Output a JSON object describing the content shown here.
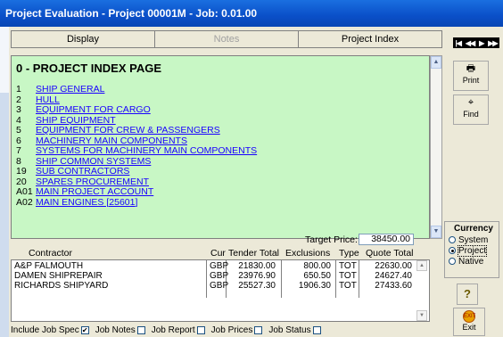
{
  "window": {
    "title": "Project Evaluation - Project 00001M - Job: 0.01.00"
  },
  "tabs": [
    {
      "label": "Display"
    },
    {
      "label": "Notes"
    },
    {
      "label": "Project Index"
    }
  ],
  "nav": {
    "icons": [
      "first-record-icon",
      "previous-record-icon",
      "next-record-icon",
      "last-record-icon"
    ]
  },
  "index": {
    "title": "0 - PROJECT INDEX PAGE",
    "items": [
      {
        "num": "1",
        "label": "SHIP GENERAL"
      },
      {
        "num": "2",
        "label": "HULL"
      },
      {
        "num": "3",
        "label": "EQUIPMENT FOR CARGO"
      },
      {
        "num": "4",
        "label": "SHIP EQUIPMENT"
      },
      {
        "num": "5",
        "label": "EQUIPMENT FOR CREW & PASSENGERS"
      },
      {
        "num": "6",
        "label": "MACHINERY MAIN COMPONENTS"
      },
      {
        "num": "7",
        "label": "SYSTEMS FOR MACHINERY MAIN COMPONENTS"
      },
      {
        "num": "8",
        "label": "SHIP COMMON SYSTEMS"
      },
      {
        "num": "19",
        "label": "SUB CONTRACTORS"
      },
      {
        "num": "20",
        "label": "SPARES PROCUREMENT"
      },
      {
        "num": "A01",
        "label": "MAIN PROJECT ACCOUNT"
      },
      {
        "num": "A02",
        "label": "MAIN ENGINES [25601]"
      }
    ]
  },
  "side": {
    "print_label": "Print",
    "find_label": "Find",
    "exit_label": "Exit",
    "exit_icon_text": "EXIT",
    "help_glyph": "?"
  },
  "target": {
    "label": "Target Price:",
    "value": "38450.00"
  },
  "table": {
    "headers": {
      "contractor": "Contractor",
      "cur": "Cur",
      "tender": "Tender Total",
      "exclusions": "Exclusions",
      "type": "Type",
      "quote": "Quote Total"
    },
    "rows": [
      {
        "contractor": "A&P FALMOUTH",
        "cur": "GBP",
        "tender": "21830.00",
        "exclusions": "800.00",
        "type": "TOT",
        "quote": "22630.00"
      },
      {
        "contractor": "DAMEN SHIPREPAIR",
        "cur": "GBP",
        "tender": "23976.90",
        "exclusions": "650.50",
        "type": "TOT",
        "quote": "24627.40"
      },
      {
        "contractor": "RICHARDS SHIPYARD",
        "cur": "GBP",
        "tender": "25527.30",
        "exclusions": "1906.30",
        "type": "TOT",
        "quote": "27433.60"
      }
    ]
  },
  "checks": [
    {
      "label": "Include Job Spec",
      "checked": true
    },
    {
      "label": "Job Notes",
      "checked": false
    },
    {
      "label": "Job Report",
      "checked": false
    },
    {
      "label": "Job Prices",
      "checked": false
    },
    {
      "label": "Job Status",
      "checked": false
    }
  ],
  "currency": {
    "title": "Currency",
    "options": [
      {
        "label": "System",
        "selected": false
      },
      {
        "label": "Project",
        "selected": true
      },
      {
        "label": "Native",
        "selected": false
      }
    ]
  },
  "colors": {
    "titlebar": "#0a4fc8",
    "pane_bg": "#c8f7c5",
    "link": "#1a00ff"
  }
}
